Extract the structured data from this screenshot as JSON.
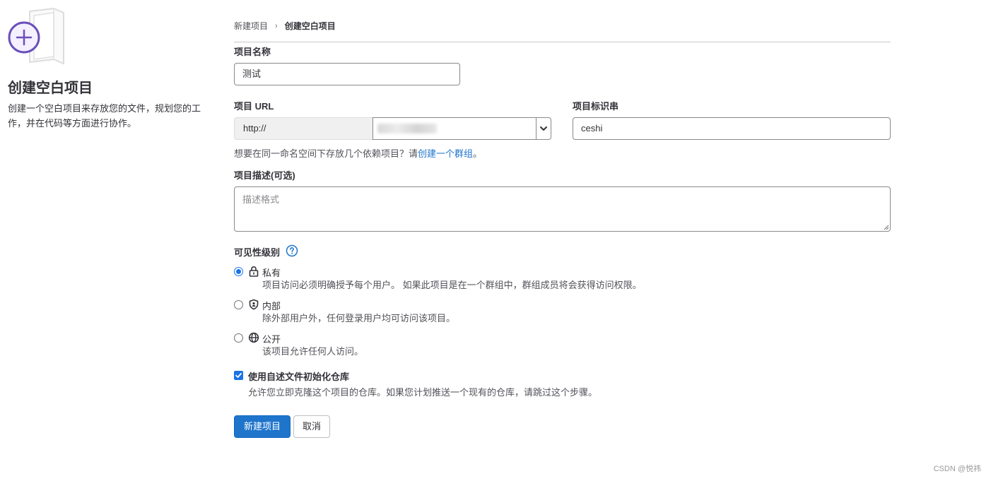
{
  "left_panel": {
    "title": "创建空白项目",
    "description": "创建一个空白项目来存放您的文件，规划您的工作，并在代码等方面进行协作。"
  },
  "breadcrumb": {
    "parent": "新建项目",
    "separator": "›",
    "current": "创建空白项目"
  },
  "form": {
    "name_label": "项目名称",
    "name_value": "测试",
    "url_label": "项目 URL",
    "url_prefix": "http://",
    "slug_label": "项目标识串",
    "slug_value": "ceshi",
    "hint_text": "想要在同一命名空间下存放几个依赖项目？请",
    "hint_link": "创建一个群组",
    "hint_end": "。",
    "desc_label": "项目描述(可选)",
    "desc_placeholder": "描述格式",
    "visibility_label": "可见性级别",
    "visibility_options": [
      {
        "icon": "lock-icon",
        "title": "私有",
        "desc": "项目访问必须明确授予每个用户。 如果此项目是在一个群组中，群组成员将会获得访问权限。",
        "checked": true
      },
      {
        "icon": "shield-icon",
        "title": "内部",
        "desc": "除外部用户外，任何登录用户均可访问该项目。",
        "checked": false
      },
      {
        "icon": "globe-icon",
        "title": "公开",
        "desc": "该项目允许任何人访问。",
        "checked": false
      }
    ],
    "readme_label": "使用自述文件初始化仓库",
    "readme_checked": true,
    "readme_desc": "允许您立即克隆这个项目的仓库。如果您计划推送一个现有的仓库，请跳过这个步骤。"
  },
  "buttons": {
    "create": "新建项目",
    "cancel": "取消"
  },
  "watermark": "CSDN @悦祎",
  "colors": {
    "primary": "#1f75cb",
    "accent_purple": "#6b4fbb",
    "text": "#333238"
  }
}
